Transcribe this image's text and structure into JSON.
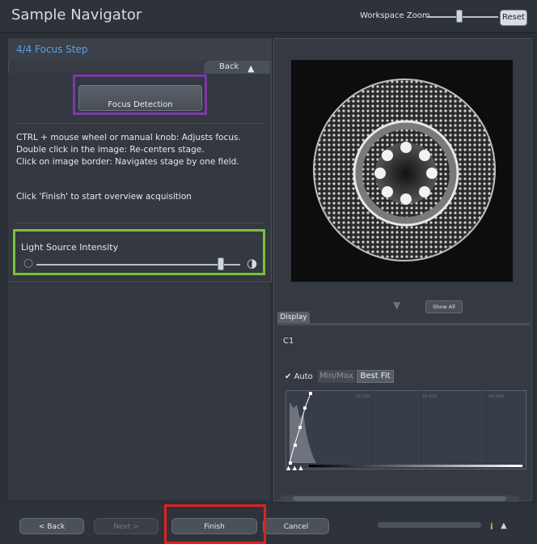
{
  "window": {
    "title": "Sample Navigator"
  },
  "workspace_zoom": {
    "label": "Workspace Zoom",
    "reset_label": "Reset"
  },
  "step": {
    "title": "4/4 Focus Step",
    "back_label": "Back"
  },
  "focus": {
    "button_label": "Focus Detection"
  },
  "instructions": [
    "CTRL + mouse wheel or manual knob: Adjusts focus.",
    "Double click in the image:  Re-centers stage.",
    "Click on image border: Navigates stage by one field."
  ],
  "finish_hint": "Click 'Finish' to start overview acquisition",
  "light": {
    "label": "Light Source Intensity",
    "level_fraction": 0.95
  },
  "display": {
    "show_all_label": "Show All",
    "tab_label": "Display",
    "channel": "C1",
    "auto_label": "Auto",
    "minmax_label": "Min/Max",
    "bestfit_label": "Best Fit",
    "histogram_ticks": [
      "10,000",
      "20,000",
      "40,000"
    ]
  },
  "footer": {
    "back_label": "< Back",
    "next_label": "Next >",
    "finish_label": "Finish",
    "cancel_label": "Cancel"
  },
  "colors": {
    "focus_highlight": "#7a3aa6",
    "light_highlight": "#7ac03c",
    "finish_highlight": "#e02020",
    "step_title": "#5aa3e6"
  }
}
